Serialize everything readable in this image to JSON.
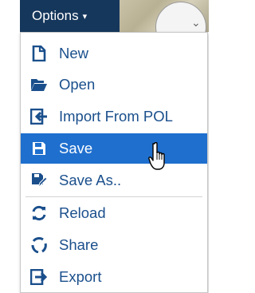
{
  "options_button": {
    "label": "Options",
    "caret": "▾"
  },
  "menu": {
    "items": [
      {
        "label": "New",
        "icon": "new-file-icon"
      },
      {
        "label": "Open",
        "icon": "folder-open-icon"
      },
      {
        "label": "Import From POL",
        "icon": "import-icon"
      },
      {
        "label": "Save",
        "icon": "floppy-disk-icon",
        "active": true
      },
      {
        "label": "Save As..",
        "icon": "save-as-icon"
      },
      {
        "label": "Reload",
        "icon": "reload-icon"
      },
      {
        "label": "Share",
        "icon": "share-icon"
      },
      {
        "label": "Export",
        "icon": "export-icon"
      }
    ]
  },
  "colors": {
    "header_bg": "#16375c",
    "menu_text": "#1a4f8c",
    "active_bg": "#1f6fce"
  }
}
